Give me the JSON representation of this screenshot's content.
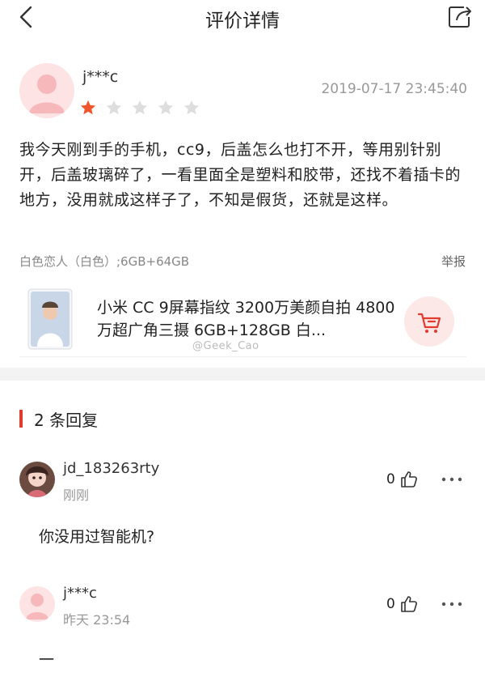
{
  "header": {
    "title": "评价详情"
  },
  "review": {
    "username": "j***c",
    "datetime": "2019-07-17 23:45:40",
    "rating": 1,
    "rating_max": 5,
    "text": "我今天刚到手的手机，cc9，后盖怎么也打不开，等用别针别开，后盖玻璃碎了，一看里面全是塑料和胶带，还找不着插卡的地方，没用就成这样子了，不知是假货，还就是这样。",
    "spec": "白色恋人（白色）;6GB+64GB",
    "report_label": "举报"
  },
  "product": {
    "title": "小米 CC 9屏幕指纹 3200万美颜自拍 4800万超广角三摄 6GB+128GB 白...",
    "watermark": "@Geek_Cao"
  },
  "replies_section": {
    "count_label": "2  条回复"
  },
  "replies": [
    {
      "username": "jd_183263rty",
      "time": "刚刚",
      "likes": "0",
      "text": "你没用过智能机?"
    },
    {
      "username": "j***c",
      "time": "昨天 23:54",
      "likes": "0",
      "text": "一"
    }
  ],
  "colors": {
    "accent": "#e23b2e",
    "star_active": "#f2552c",
    "star_inactive": "#dddddd",
    "avatar_bg": "#fde3e4"
  }
}
